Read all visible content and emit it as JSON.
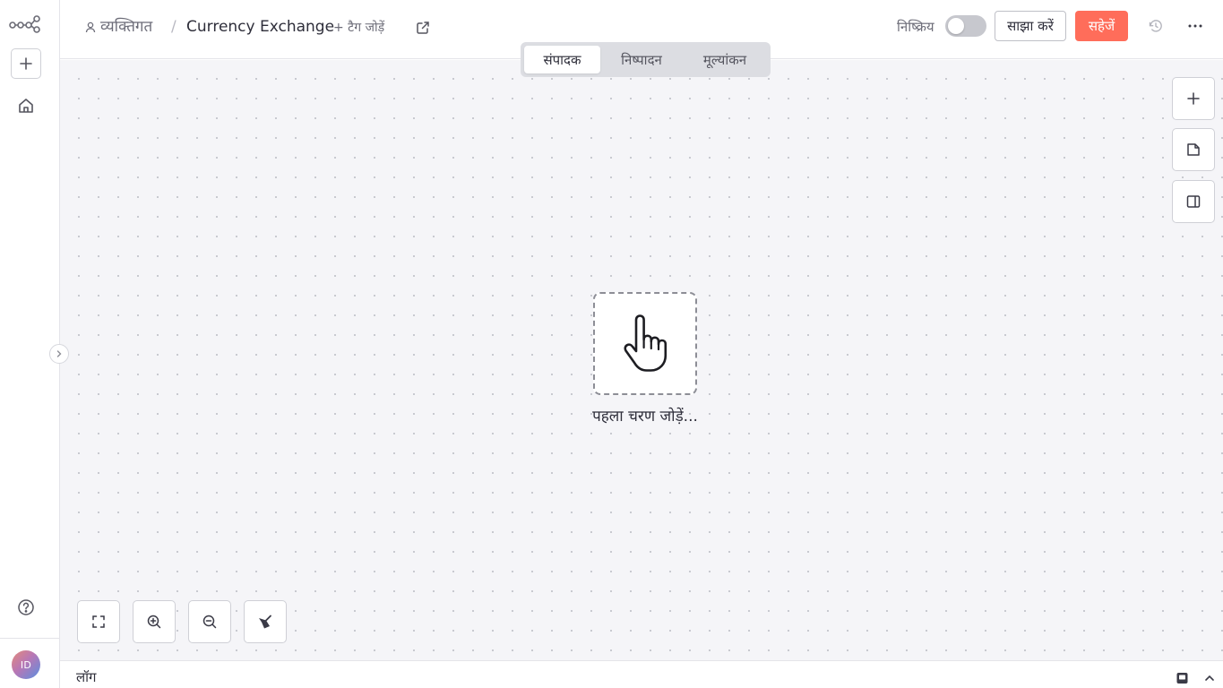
{
  "sidebar": {
    "avatar_initials": "ID"
  },
  "header": {
    "breadcrumb_personal": "व्यक्तिगत",
    "breadcrumb_separator": "/",
    "workflow_title": "Currency Exchange",
    "add_tag": "+ टैग जोड़ें",
    "inactive_label": "निष्क्रिय",
    "share_label": "साझा करें",
    "save_label": "सहेजें"
  },
  "tabs": [
    {
      "label": "संपादक",
      "active": true
    },
    {
      "label": "निष्पादन",
      "active": false
    },
    {
      "label": "मूल्यांकन",
      "active": false
    }
  ],
  "canvas": {
    "trigger_label": "पहला चरण जोड़ें..."
  },
  "logs": {
    "label": "लॉग"
  },
  "colors": {
    "accent": "#ff6d5a",
    "canvas_bg": "#f5f5f8",
    "toggle_off": "#c7c8ce"
  },
  "icons": {
    "logo": "workflow-logo-icon",
    "add": "plus-icon",
    "home": "home-icon",
    "help": "help-icon",
    "expand": "chevron-right-icon",
    "external": "external-link-icon",
    "history": "history-icon",
    "more": "more-horizontal-icon",
    "sticky": "sticky-note-icon",
    "panel": "side-panel-icon",
    "trigger": "hand-pointer-icon",
    "fit": "fit-view-icon",
    "zoom_in": "zoom-in-icon",
    "zoom_out": "zoom-out-icon",
    "tidy": "tidy-up-icon",
    "popout": "pop-out-icon",
    "collapse": "chevron-up-icon"
  }
}
